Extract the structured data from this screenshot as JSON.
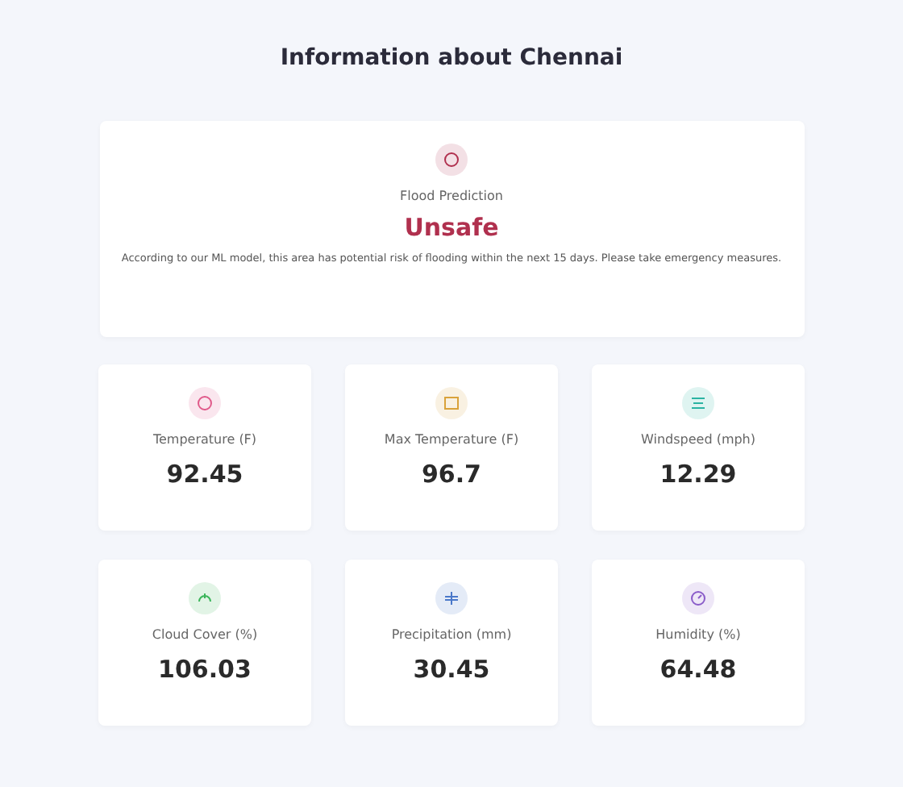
{
  "title": "Information about Chennai",
  "prediction": {
    "label": "Flood Prediction",
    "status": "Unsafe",
    "color": "#b0304e",
    "message": "According to our ML model, this area has potential risk of flooding within the next 15 days. Please take emergency measures."
  },
  "stats": [
    {
      "label": "Temperature (F)",
      "value": "92.45",
      "color": "#e05a8a"
    },
    {
      "label": "Max Temperature (F)",
      "value": "96.7",
      "color": "#d9a23a"
    },
    {
      "label": "Windspeed (mph)",
      "value": "12.29",
      "color": "#2bb3a3"
    },
    {
      "label": "Cloud Cover (%)",
      "value": "106.03",
      "color": "#3bb55a"
    },
    {
      "label": "Precipitation (mm)",
      "value": "30.45",
      "color": "#4a78c9"
    },
    {
      "label": "Humidity (%)",
      "value": "64.48",
      "color": "#8a5cc9"
    }
  ]
}
